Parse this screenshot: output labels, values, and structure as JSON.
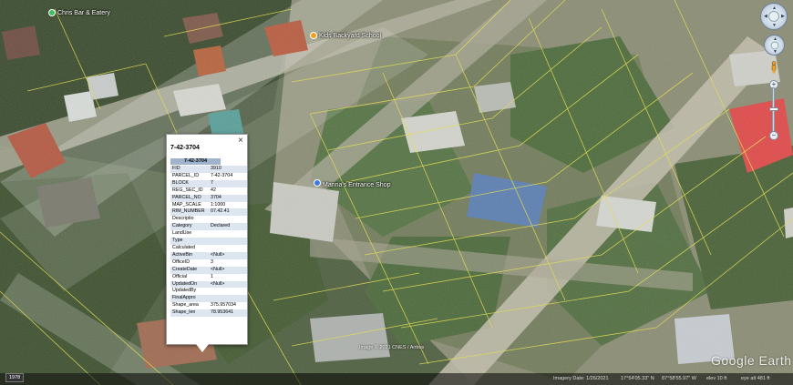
{
  "map": {
    "places": [
      {
        "name": "Chris Bar & Eatery",
        "color": "#3fbf5f"
      },
      {
        "name": "Kids Backyard School",
        "color": "#f29d1e"
      },
      {
        "name": "Marina's Entrance Shop",
        "color": "#3d7be0"
      }
    ],
    "imagery_credit": "Image © 2021 CNES / Airbus"
  },
  "popup": {
    "title": "7-42-3704",
    "close_glyph": "×",
    "table_header": "7-42-3704",
    "attributes": [
      {
        "key": "FID",
        "value": "3910"
      },
      {
        "key": "PARCEL_ID",
        "value": "7-42-3704"
      },
      {
        "key": "BLOCK",
        "value": "7"
      },
      {
        "key": "REG_SEC_ID",
        "value": "42"
      },
      {
        "key": "PARCEL_NO",
        "value": "3704"
      },
      {
        "key": "MAP_SCALE",
        "value": "1:1000"
      },
      {
        "key": "RIM_NUMBER",
        "value": "07.42.41"
      },
      {
        "key": "Descriptio",
        "value": ""
      },
      {
        "key": "Category",
        "value": "Declared"
      },
      {
        "key": "LandUse",
        "value": ""
      },
      {
        "key": "Type",
        "value": ""
      },
      {
        "key": "Calculated",
        "value": ""
      },
      {
        "key": "ActiveBin",
        "value": "<Null>"
      },
      {
        "key": "OfficeID",
        "value": "3"
      },
      {
        "key": "CreateDate",
        "value": "<Null>"
      },
      {
        "key": "Official",
        "value": "1"
      },
      {
        "key": "UpdatedOn",
        "value": "<Null>"
      },
      {
        "key": "UpdatedBy",
        "value": ""
      },
      {
        "key": "FinalAppro",
        "value": ""
      },
      {
        "key": "Shape_area",
        "value": "375.957034"
      },
      {
        "key": "Shape_len",
        "value": "78.953641"
      }
    ]
  },
  "controls": {
    "zoom_in": "+",
    "zoom_out": "−"
  },
  "status": {
    "scale_year": "1978",
    "imagery_date": "Imagery Date: 1/26/2021",
    "lat": "17°54'05.33\" N",
    "lon": "87°58'55.97\" W",
    "elev": "elev   10 ft",
    "eye_alt": "eye alt   481 ft"
  },
  "watermark": "Google Earth",
  "colors": {
    "parcel_line": "#e6e04a",
    "popup_header": "#9fb3cc",
    "row_alt": "#dde6f0"
  }
}
